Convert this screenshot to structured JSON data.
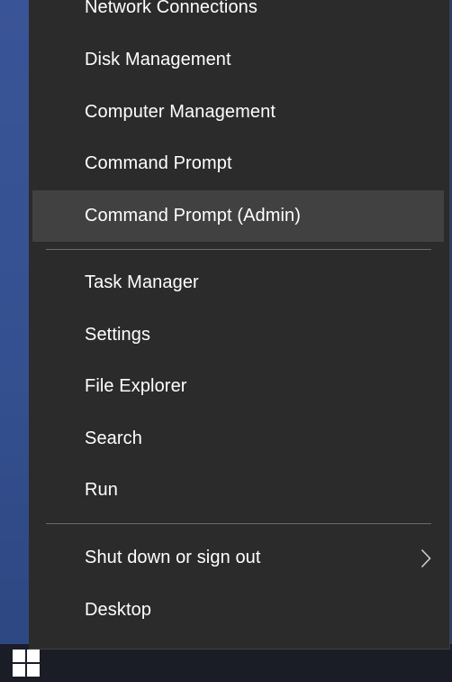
{
  "menu": {
    "items": [
      {
        "label": "Network Connections"
      },
      {
        "label": "Disk Management"
      },
      {
        "label": "Computer Management"
      },
      {
        "label": "Command Prompt"
      },
      {
        "label": "Command Prompt (Admin)"
      },
      {
        "label": "Task Manager"
      },
      {
        "label": "Settings"
      },
      {
        "label": "File Explorer"
      },
      {
        "label": "Search"
      },
      {
        "label": "Run"
      },
      {
        "label": "Shut down or sign out"
      },
      {
        "label": "Desktop"
      }
    ]
  },
  "colors": {
    "menu_background": "#2b2b2b",
    "hover_background": "#414141",
    "text": "#ffffff",
    "separator": "#6b6b6b",
    "desktop": "#3a5597",
    "taskbar": "#1b1d26"
  },
  "icons": {
    "start": "windows-logo-icon",
    "submenu": "chevron-right-icon"
  }
}
